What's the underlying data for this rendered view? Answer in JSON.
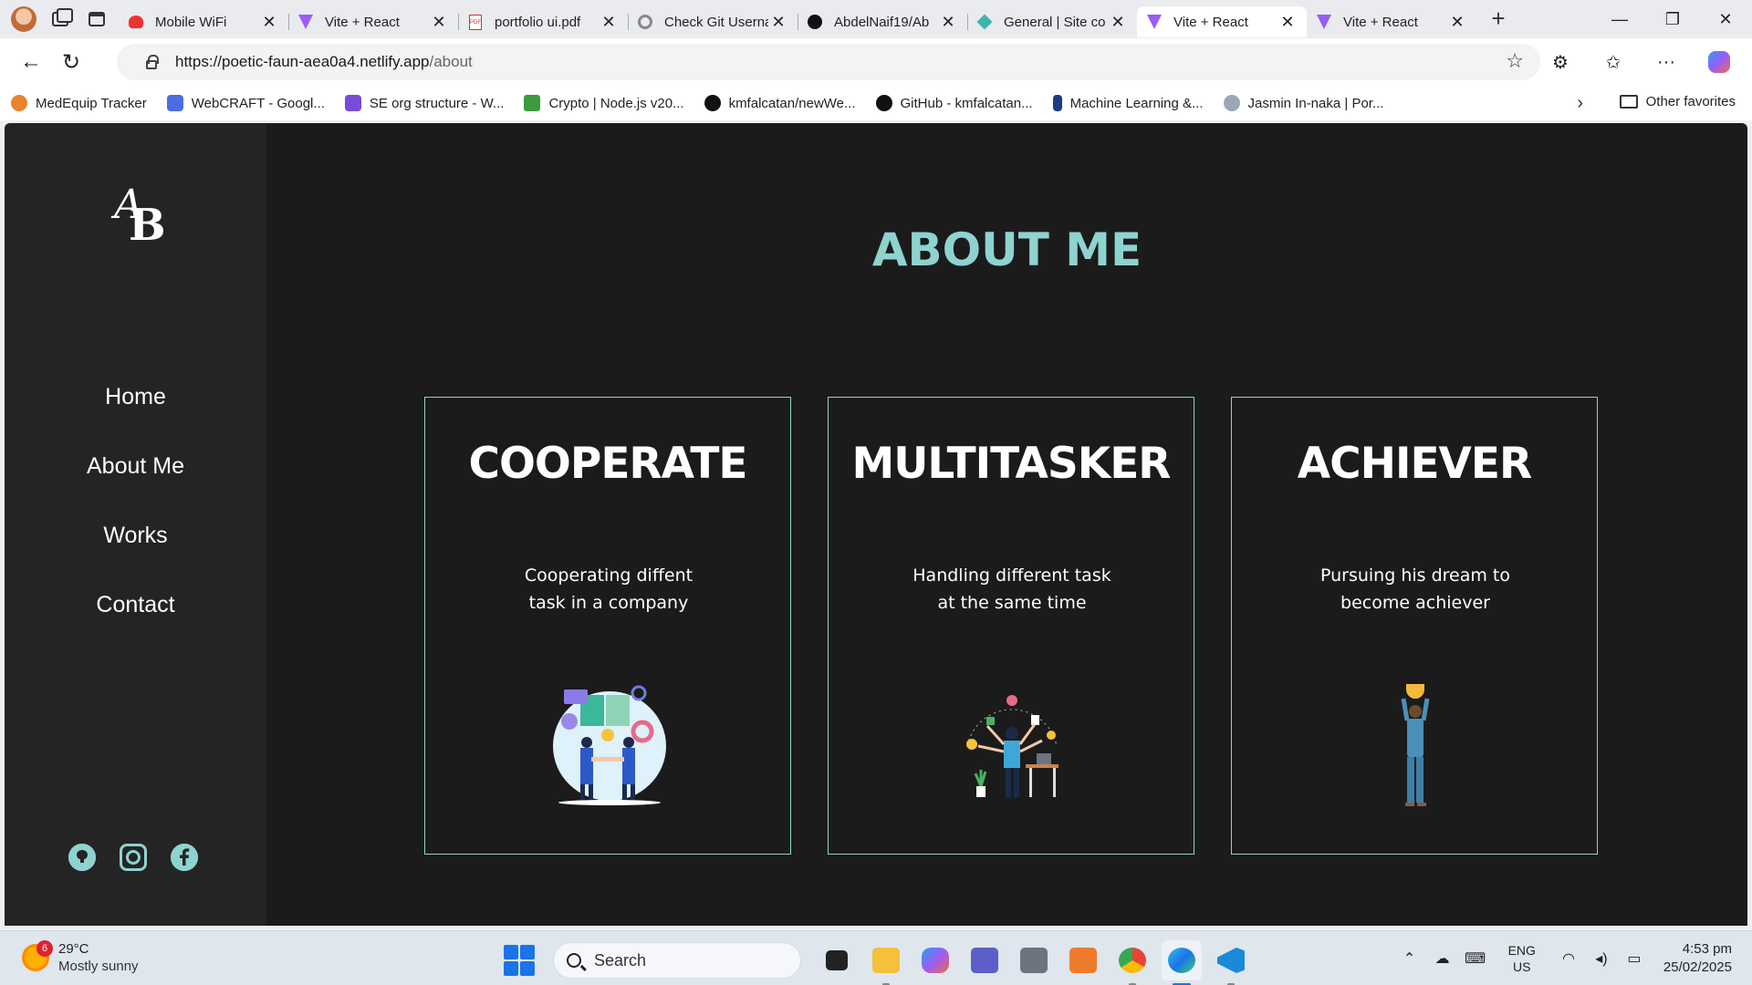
{
  "browser": {
    "tabs": [
      {
        "title": "Mobile WiFi",
        "icon": "huawei-icon",
        "active": false
      },
      {
        "title": "Vite + React",
        "icon": "vite-icon",
        "active": false
      },
      {
        "title": "portfolio ui.pdf",
        "icon": "pdf-icon",
        "active": false
      },
      {
        "title": "Check Git Userna",
        "icon": "globe-icon",
        "active": false
      },
      {
        "title": "AbdelNaif19/Ab",
        "icon": "github-icon",
        "active": false
      },
      {
        "title": "General | Site co",
        "icon": "netlify-icon",
        "active": false
      },
      {
        "title": "Vite + React",
        "icon": "vite-icon",
        "active": true
      },
      {
        "title": "Vite + React",
        "icon": "vite-icon",
        "active": false
      }
    ],
    "url_host": "https://poetic-faun-aea0a4.netlify.app",
    "url_path": "/about",
    "favorites": [
      {
        "label": "MedEquip Tracker",
        "color": "#e8842c"
      },
      {
        "label": "WebCRAFT - Googl...",
        "color": "#4a6ee0"
      },
      {
        "label": "SE org structure - W...",
        "color": "#7a4bd8"
      },
      {
        "label": "Crypto | Node.js v20...",
        "color": "#3c9a3c"
      },
      {
        "label": "kmfalcatan/newWe...",
        "color": "#111111"
      },
      {
        "label": "GitHub - kmfalcatan...",
        "color": "#111111"
      },
      {
        "label": "Machine Learning &...",
        "color": "#1f3a8a"
      },
      {
        "label": "Jasmin In-naka | Por...",
        "color": "#9aa7b8"
      }
    ],
    "other_favorites": "Other favorites"
  },
  "site": {
    "logo_a": "A",
    "logo_b": "B",
    "nav": [
      "Home",
      "About Me",
      "Works",
      "Contact"
    ],
    "page_title": "ABOUT ME",
    "cards": [
      {
        "title": "COOPERATE",
        "text": "Cooperating diffent task in a company",
        "illustration": "handshake-puzzle-illustration"
      },
      {
        "title": "MULTITASKER",
        "text": "Handling different task at the same time",
        "illustration": "multitasking-person-illustration"
      },
      {
        "title": "ACHIEVER",
        "text": "Pursuing his dream to become achiever",
        "illustration": "trophy-holder-illustration"
      }
    ],
    "socials": [
      "github-icon",
      "instagram-icon",
      "facebook-icon"
    ],
    "accent": "#8ed3d0"
  },
  "taskbar": {
    "weather_badge": "6",
    "temperature": "29°C",
    "condition": "Mostly sunny",
    "search_placeholder": "Search",
    "lang_top": "ENG",
    "lang_bottom": "US",
    "time": "4:53 pm",
    "date": "25/02/2025"
  }
}
